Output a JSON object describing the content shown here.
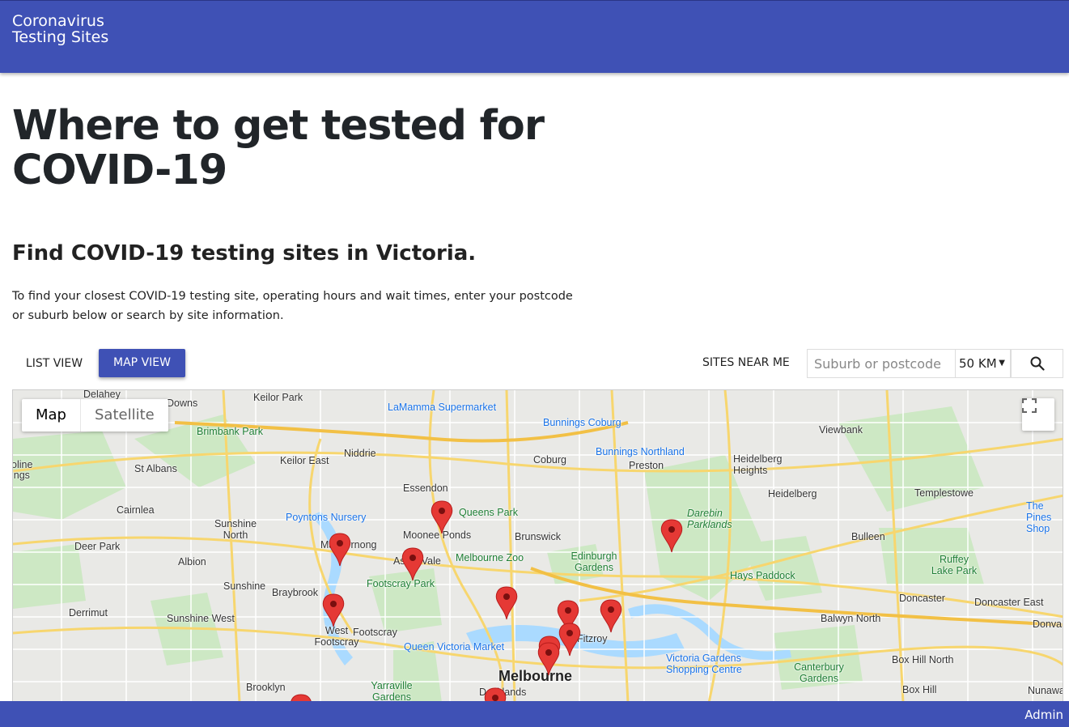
{
  "header": {
    "brand": "Coronavirus Testing Sites"
  },
  "main": {
    "title": "Where to get tested for COVID-19",
    "subtitle": "Find COVID-19 testing sites in Victoria.",
    "intro": "To find your closest COVID-19 testing site, operating hours and wait times, enter your postcode or suburb below or search by site information."
  },
  "view_toggle": {
    "list": "LIST VIEW",
    "map": "MAP VIEW",
    "active": "map"
  },
  "search": {
    "near_label": "SITES NEAR ME",
    "placeholder": "Suburb or postcode",
    "distance": "50 KM"
  },
  "map": {
    "type_map": "Map",
    "type_satellite": "Satellite",
    "labels": {
      "delahey": "Delahey",
      "downs": "Downs",
      "keilor_park": "Keilor Park",
      "lamanna": "LaMamma Supermarket",
      "brimbank": "Brimbank Park",
      "bunnings_coburg": "Bunnings Coburg",
      "viewbank": "Viewbank",
      "keilor_east": "Keilor East",
      "niddrie": "Niddrie",
      "coburg": "Coburg",
      "bunnings_northland": "Bunnings Northland",
      "preston": "Preston",
      "heidelberg_heights": "Heidelberg Heights",
      "st_albans": "St Albans",
      "essendon": "Essendon",
      "heidelberg": "Heidelberg",
      "templestowe": "Templestowe",
      "cairnlea": "Cairnlea",
      "poyntons": "Poyntons Nursery",
      "queens_park": "Queens Park",
      "darebin": "Darebin Parklands",
      "sunshine_north": "Sunshine North",
      "moonee_ponds": "Moonee Ponds",
      "brunswick": "Brunswick",
      "bulleen": "Bulleen",
      "deer_park": "Deer Park",
      "maribyrnong": "Maribyrnong",
      "albion": "Albion",
      "ascot_vale": "Ascot Vale",
      "melbourne_zoo": "Melbourne Zoo",
      "edinburgh": "Edinburgh Gardens",
      "ruffey": "Ruffey Lake Park",
      "footscray_park": "Footscray Park",
      "hays": "Hays Paddock",
      "sunshine": "Sunshine",
      "braybrook": "Braybrook",
      "derrimut": "Derrimut",
      "doncaster": "Doncaster",
      "doncaster_east": "Doncaster East",
      "sunshine_west": "Sunshine West",
      "west_footscray": "West Footscray",
      "footscray": "Footscray",
      "balwyn_north": "Balwyn North",
      "donvale": "Donval",
      "fitzroy": "Fitzroy",
      "queen_vic": "Queen Victoria Market",
      "victoria_gardens": "Victoria Gardens Shopping Centre",
      "box_hill_north": "Box Hill North",
      "melbourne": "Melbourne",
      "canterbury": "Canterbury Gardens",
      "brooklyn": "Brooklyn",
      "yarraville": "Yarraville Gardens",
      "docklands": "Docklands",
      "box_hill": "Box Hill",
      "nunawading": "Nunawadi",
      "the_pines": "The Pines Shop",
      "caroline": "oline ings"
    }
  },
  "footer": {
    "admin": "Admin"
  }
}
